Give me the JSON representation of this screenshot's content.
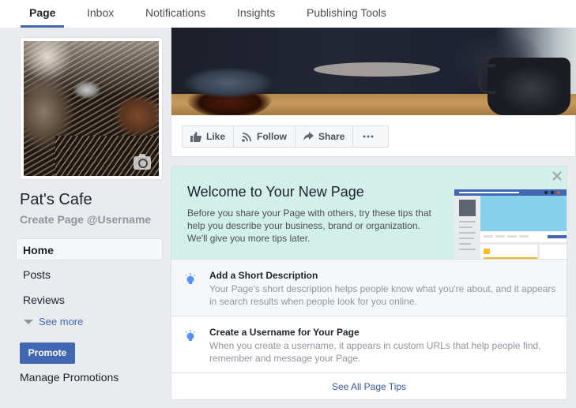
{
  "nav": {
    "tabs": [
      {
        "label": "Page",
        "active": true
      },
      {
        "label": "Inbox",
        "active": false
      },
      {
        "label": "Notifications",
        "active": false
      },
      {
        "label": "Insights",
        "active": false
      },
      {
        "label": "Publishing Tools",
        "active": false
      }
    ],
    "accent_color": "#4267b2"
  },
  "sidebar": {
    "page_name": "Pat's Cafe",
    "username_link": "Create Page @Username",
    "items": [
      {
        "label": "Home",
        "active": true
      },
      {
        "label": "Posts",
        "active": false
      },
      {
        "label": "Reviews",
        "active": false
      }
    ],
    "see_more": "See more",
    "promote_button": "Promote",
    "manage_promotions": "Manage Promotions",
    "profile_photo_icon": "camera-icon"
  },
  "cover": {
    "actions": [
      {
        "label": "Like",
        "icon": "thumbs-up-icon"
      },
      {
        "label": "Follow",
        "icon": "rss-icon"
      },
      {
        "label": "Share",
        "icon": "share-arrow-icon"
      },
      {
        "label": "",
        "icon": "more-dots-icon"
      }
    ]
  },
  "welcome": {
    "title": "Welcome to Your New Page",
    "text": "Before you share your Page with others, try these tips that help you describe your business, brand or organization. We'll give you more tips later.",
    "close_icon": "close-icon",
    "tips": [
      {
        "title": "Add a Short Description",
        "text": "Your Page's short description helps people know what you're about, and it appears in search results when people look for you online.",
        "icon": "lightbulb-icon"
      },
      {
        "title": "Create a Username for Your Page",
        "text": "When you create a username, it appears in custom URLs that help people find, remember and message your Page.",
        "icon": "lightbulb-icon"
      }
    ],
    "see_all": "See All Page Tips"
  }
}
